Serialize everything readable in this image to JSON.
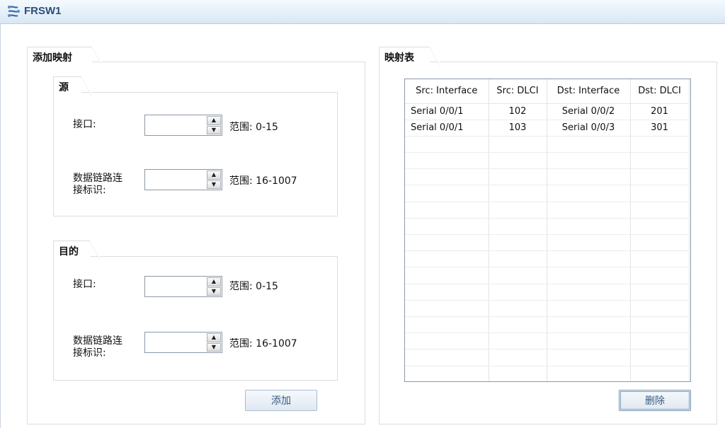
{
  "window": {
    "title": "FRSW1",
    "icon": "network-switch-icon"
  },
  "add_mapping": {
    "tab_label": "添加映射",
    "source": {
      "tab_label": "源",
      "interface_label": "接口:",
      "interface_value": "",
      "interface_range": "范围: 0-15",
      "dlci_label_line1": "数据链路连",
      "dlci_label_line2": "接标识:",
      "dlci_value": "",
      "dlci_range": "范围: 16-1007"
    },
    "destination": {
      "tab_label": "目的",
      "interface_label": "接口:",
      "interface_value": "",
      "interface_range": "范围: 0-15",
      "dlci_label_line1": "数据链路连",
      "dlci_label_line2": "接标识:",
      "dlci_value": "",
      "dlci_range": "范围: 16-1007"
    },
    "add_button": "添加"
  },
  "mapping_table": {
    "tab_label": "映射表",
    "columns": [
      "Src: Interface",
      "Src: DLCI",
      "Dst: Interface",
      "Dst: DLCI"
    ],
    "rows": [
      [
        "Serial 0/0/1",
        "102",
        "Serial 0/0/2",
        "201"
      ],
      [
        "Serial 0/0/1",
        "103",
        "Serial 0/0/3",
        "301"
      ]
    ],
    "delete_button": "删除"
  }
}
